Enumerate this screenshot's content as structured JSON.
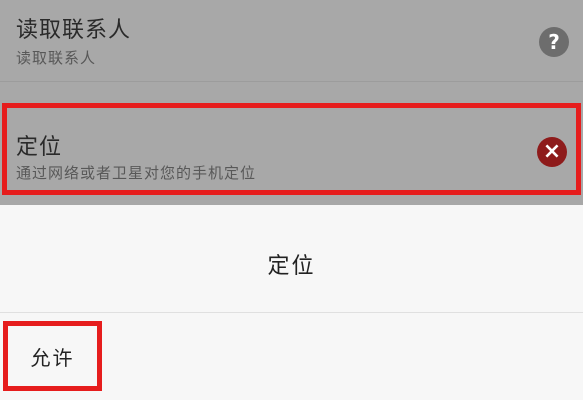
{
  "permissions": [
    {
      "title": "读取联系人",
      "description": "读取联系人",
      "status_icon": "help-icon"
    },
    {
      "title": "定位",
      "description": "通过网络或者卫星对您的手机定位",
      "status_icon": "deny-icon"
    }
  ],
  "dialog": {
    "title": "定位",
    "allow_label": "允许"
  },
  "icons": {
    "help_symbol": "?",
    "deny_symbol": "×"
  },
  "colors": {
    "highlight": "#e61d1d",
    "deny_icon": "#8e1b1b",
    "help_icon": "#6d6d6d",
    "dimmed_background": "#a8a8a8"
  }
}
